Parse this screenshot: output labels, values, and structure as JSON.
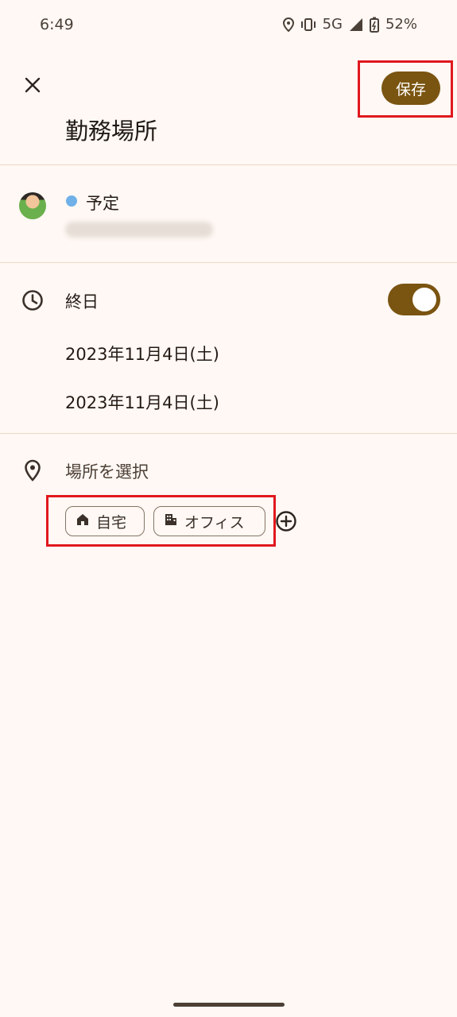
{
  "status_bar": {
    "time": "6:49",
    "network": "5G",
    "battery": "52%",
    "icons": [
      "location-icon",
      "vibrate-icon",
      "signal-icon",
      "battery-charging-icon"
    ]
  },
  "header": {
    "close_icon": "close-icon",
    "save_label": "保存",
    "title": "勤務場所"
  },
  "calendar": {
    "name": "予定",
    "color": "#6fb0e8"
  },
  "time_section": {
    "icon": "clock-icon",
    "all_day_label": "終日",
    "all_day_on": true,
    "start_date": "2023年11月4日(土)",
    "end_date": "2023年11月4日(土)"
  },
  "location_section": {
    "icon": "location-pin-icon",
    "placeholder": "場所を選択",
    "chips": [
      {
        "label": "自宅",
        "icon": "home-icon"
      },
      {
        "label": "オフィス",
        "icon": "building-icon"
      }
    ],
    "add_icon": "add-circle-icon"
  },
  "colors": {
    "accent": "#7a5411",
    "background": "#fff8f4",
    "highlight": "#e0181e"
  }
}
